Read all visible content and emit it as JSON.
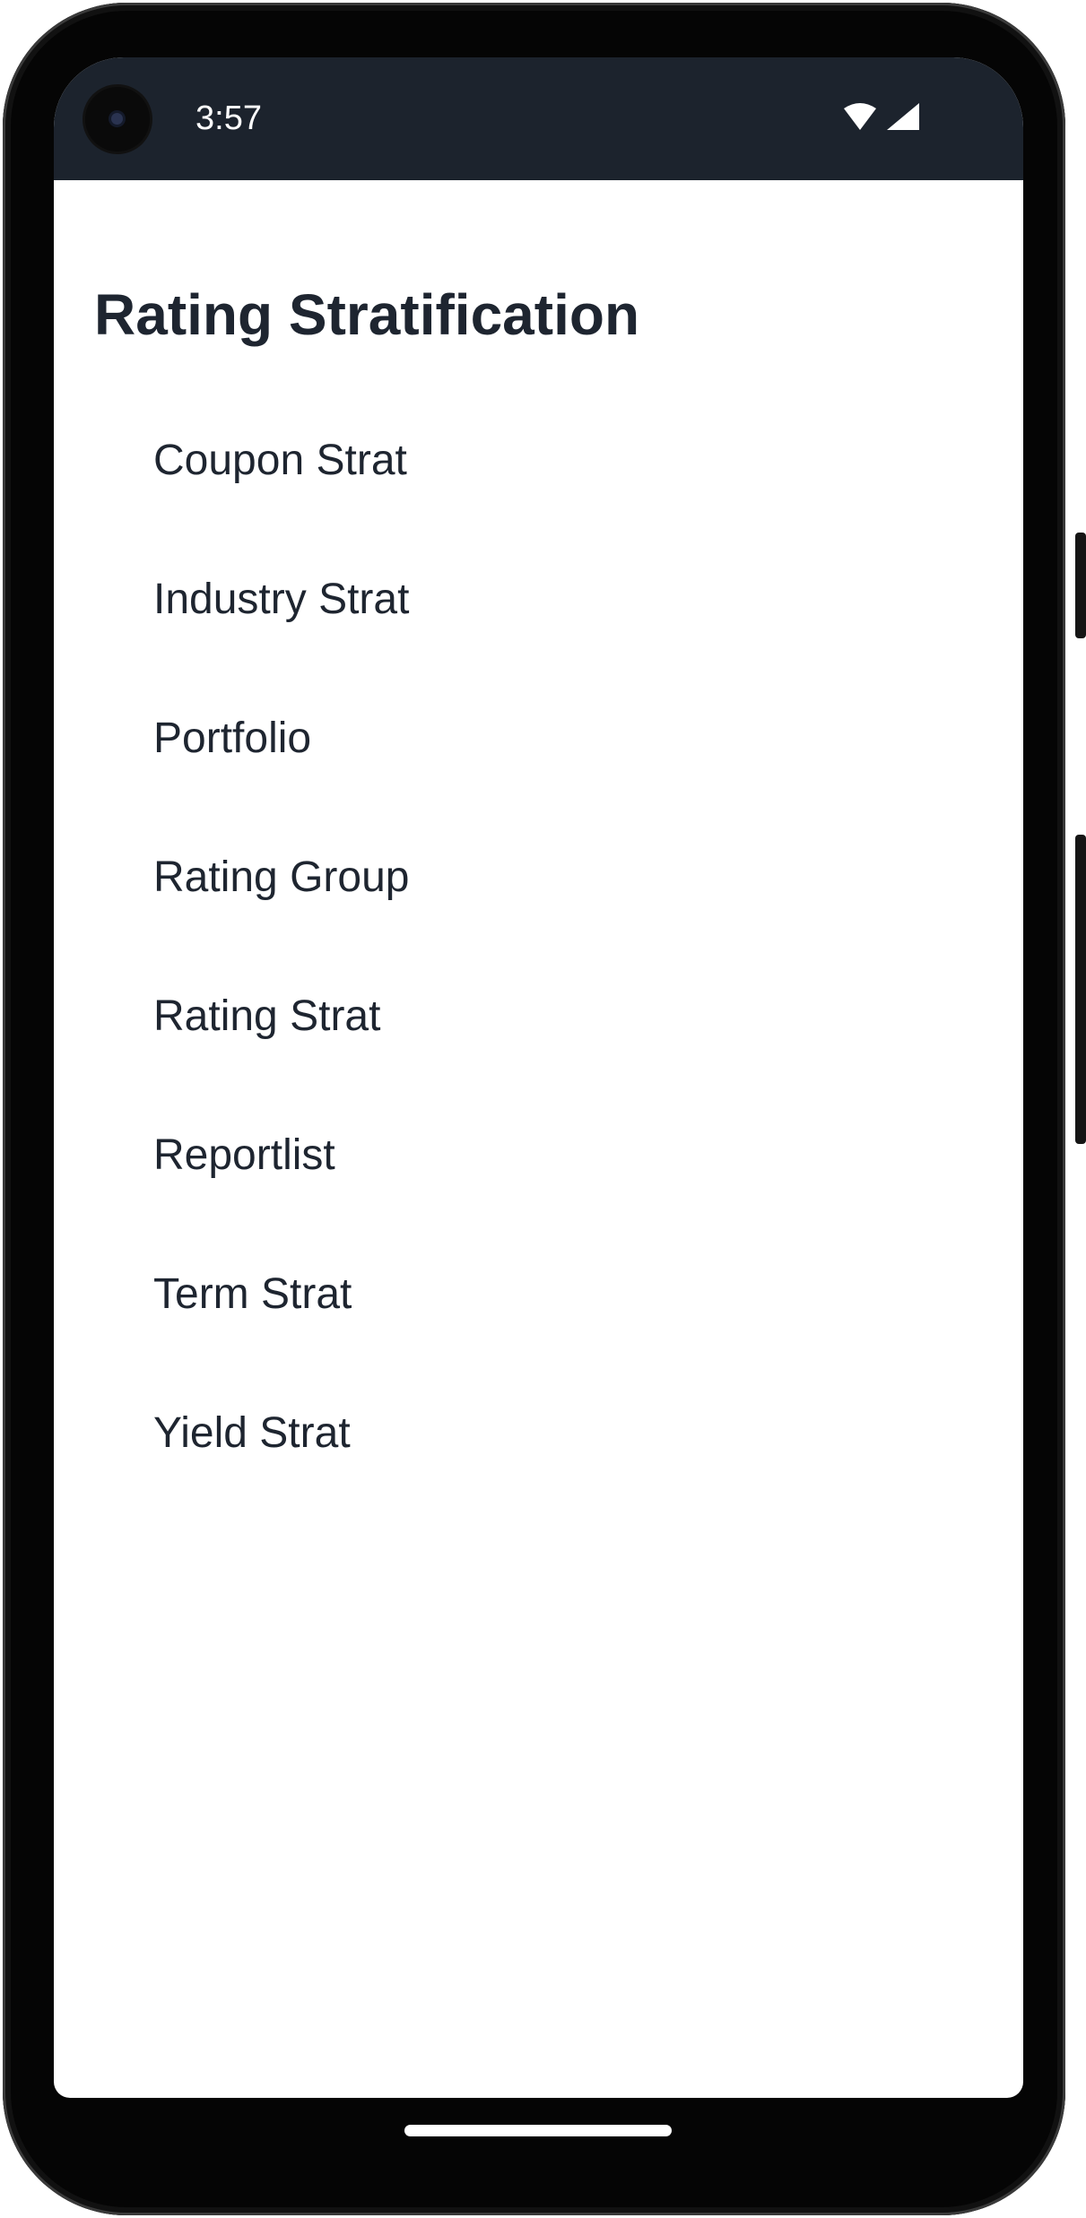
{
  "status_bar": {
    "time": "3:57",
    "icons": [
      "wifi-icon",
      "cellular-signal-icon"
    ]
  },
  "page": {
    "title": "Rating Stratification"
  },
  "menu": {
    "items": [
      {
        "label": "Coupon Strat"
      },
      {
        "label": "Industry Strat"
      },
      {
        "label": "Portfolio"
      },
      {
        "label": "Rating Group"
      },
      {
        "label": "Rating Strat"
      },
      {
        "label": "Reportlist"
      },
      {
        "label": "Term Strat"
      },
      {
        "label": "Yield Strat"
      }
    ]
  },
  "colors": {
    "status_bar_bg": "#1c232d",
    "text": "#1e2530",
    "background": "#ffffff"
  }
}
